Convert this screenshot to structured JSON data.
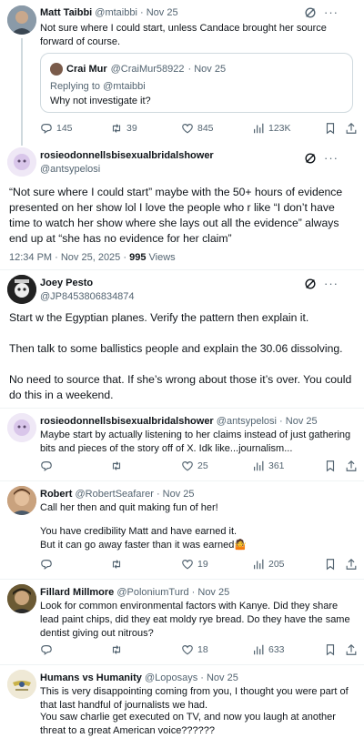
{
  "posts": [
    {
      "name": "Matt Taibbi",
      "handle": "@mtaibbi",
      "date": "· Nov 25",
      "text": "Not sure where I could start, unless Candace brought her source forward of course.",
      "quote": {
        "name": "Crai Mur",
        "handle": "@CraiMur58922",
        "date": "· Nov 25",
        "replying": "Replying to @mtaibbi",
        "text": "Why not investigate it?"
      },
      "replies": "145",
      "reposts": "39",
      "likes": "845",
      "views": "123K"
    },
    {
      "name": "rosieodonnellsbisexualbridalshower",
      "handle": "@antsypelosi",
      "text": "“Not sure where I could start” maybe with the 50+ hours of evidence presented on her show lol I love the people who r like “I don’t have time to watch her show where she lays out all the evidence” always end up at “she has no evidence for her claim”",
      "timestamp": "12:34 PM · Nov 25, 2025 · ",
      "views_count": "995",
      "views_label": " Views"
    },
    {
      "name": "Joey Pesto",
      "handle": "@JP8453806834874",
      "para1": "Start w the Egyptian planes. Verify the pattern then explain it.",
      "para2": "Then talk to some ballistics people and explain the 30.06 dissolving.",
      "para3": "No need to source that. If she’s wrong about those it’s over. You could do this in a weekend."
    },
    {
      "name": "rosieodonnellsbisexualbridalshower",
      "handle": "@antsypelosi",
      "date": "· Nov 25",
      "text": "Maybe start by actually listening to her claims instead of just gathering bits and pieces of the story off of X. Idk like...journalism...",
      "replies": "",
      "reposts": "",
      "likes": "25",
      "views": "361"
    },
    {
      "name": "Robert",
      "handle": "@RobertSeafarer",
      "date": "· Nov 25",
      "line1": "Call her then and quit making fun of her!",
      "line2": "You have credibility Matt and have earned it.",
      "line3": "But it can go away faster than it was earned🤷",
      "likes": "19",
      "views": "205"
    },
    {
      "name": "Fillard Millmore",
      "handle": "@PoloniumTurd",
      "date": "· Nov 25",
      "text": "Look for common environmental factors with Kanye. Did they share lead paint chips, did they eat moldy rye bread. Do they have the same dentist giving out nitrous?",
      "likes": "18",
      "views": "633"
    },
    {
      "name": "Humans vs Humanity",
      "handle": "@Loposays",
      "date": "· Nov 25",
      "line1": "This is very disappointing coming from you, I thought you were part of that last handful of journalists we had.",
      "line2": "You saw charlie get executed on TV, and now you laugh at another threat to a great American voice??????"
    }
  ],
  "icons": [
    "reply-icon",
    "repost-icon",
    "like-icon",
    "views-icon",
    "bookmark-icon",
    "share-icon",
    "grok-icon",
    "more-icon"
  ]
}
